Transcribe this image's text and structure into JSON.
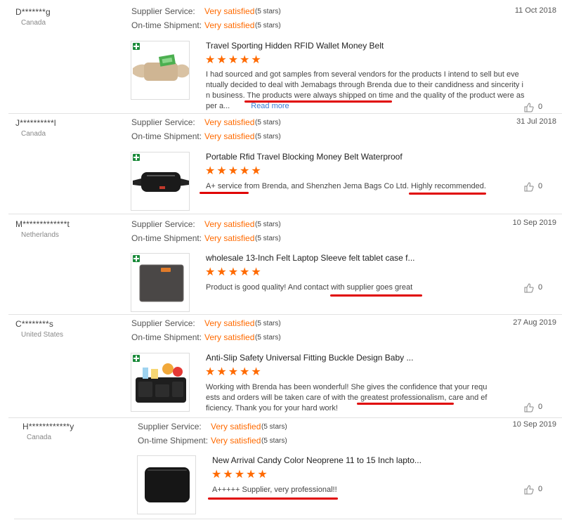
{
  "labels": {
    "supplier_service": "Supplier Service:",
    "ontime_shipment": "On-time Shipment:"
  },
  "colors": {
    "accent": "#ff6a00",
    "underline": "#e00000",
    "link": "#3a7bd5"
  },
  "reviews": [
    {
      "name": "D*******g",
      "country": "Canada",
      "date": "11 Oct 2018",
      "supplier_service": "Very satisfied",
      "supplier_stars": "(5 stars)",
      "shipment": "Very satisfied",
      "shipment_stars": "(5 stars)",
      "product_title": "Travel Sporting Hidden RFID Wallet Money Belt",
      "rating": "★★★★★",
      "text_lines": [
        "I had sourced and got samples from several vendors for the products I intend to sell but eve",
        "ntually decided to deal with Jemabags through Brenda due to their candidness and sincerity i",
        "n business. The products were always shipped on time and the quality of the product were as",
        "per a..."
      ],
      "read_more": "Read more",
      "likes": "0",
      "product_image_icon": "money-belt-image"
    },
    {
      "name": "J**********l",
      "country": "Canada",
      "date": "31 Jul 2018",
      "supplier_service": "Very satisfied",
      "supplier_stars": "(5 stars)",
      "shipment": "Very satisfied",
      "shipment_stars": "(5 stars)",
      "product_title": "Portable Rfid Travel Blocking Money Belt Waterproof",
      "rating": "★★★★★",
      "text_lines": [
        "A+ service from Brenda, and Shenzhen Jema Bags Co Ltd. Highly recommended."
      ],
      "likes": "0",
      "product_image_icon": "black-belt-image"
    },
    {
      "name": "M*************t",
      "country": "Netherlands",
      "date": "10 Sep 2019",
      "supplier_service": "Very satisfied",
      "supplier_stars": "(5 stars)",
      "shipment": "Very satisfied",
      "shipment_stars": "(5 stars)",
      "product_title": "wholesale 13-Inch Felt Laptop Sleeve felt tablet case f...",
      "rating": "★★★★★",
      "text_lines": [
        "Product is good quality! And contact with supplier goes great"
      ],
      "likes": "0",
      "product_image_icon": "felt-sleeve-image"
    },
    {
      "name": "C********s",
      "country": "United States",
      "date": "27 Aug 2019",
      "supplier_service": "Very satisfied",
      "supplier_stars": "(5 stars)",
      "shipment": "Very satisfied",
      "shipment_stars": "(5 stars)",
      "product_title": "Anti-Slip Safety Universal Fitting Buckle Design Baby ...",
      "rating": "★★★★★",
      "text_lines": [
        "Working with Brenda has been wonderful! She gives the confidence that your requ",
        "ests and orders will be taken care of with the greatest professionalism, care and ef",
        "ficiency. Thank you for your hard work!"
      ],
      "likes": "0",
      "product_image_icon": "stroller-organizer-image"
    },
    {
      "name": "H************y",
      "country": "Canada",
      "date": "10 Sep 2019",
      "supplier_service": "Very satisfied",
      "supplier_stars": "(5 stars)",
      "shipment": "Very satisfied",
      "shipment_stars": "(5 stars)",
      "product_title": "New Arrival Candy Color Neoprene 11 to 15 Inch lapto...",
      "rating": "★★★★★",
      "text_lines": [
        "A+++++ Supplier, very professional!!"
      ],
      "likes": "0",
      "product_image_icon": "neoprene-sleeve-image"
    }
  ]
}
